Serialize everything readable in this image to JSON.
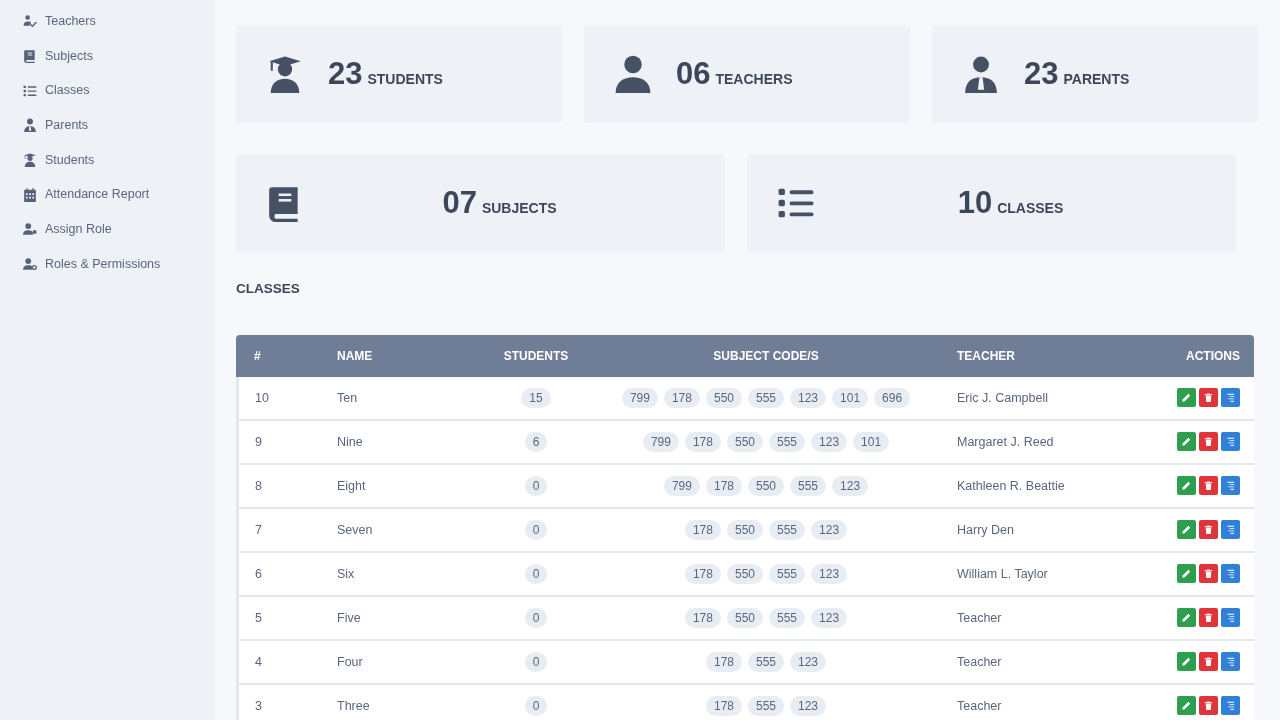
{
  "sidebar": {
    "items": [
      {
        "label": "Teachers",
        "kind": "teacher"
      },
      {
        "label": "Subjects",
        "kind": "book"
      },
      {
        "label": "Classes",
        "kind": "list"
      },
      {
        "label": "Parents",
        "kind": "parent"
      },
      {
        "label": "Students",
        "kind": "student"
      },
      {
        "label": "Attendance Report",
        "kind": "calendar"
      },
      {
        "label": "Assign Role",
        "kind": "assign"
      },
      {
        "label": "Roles & Permissions",
        "kind": "roles"
      }
    ]
  },
  "stats": [
    [
      {
        "count": "23",
        "label": "STUDENTS",
        "kind": "student"
      },
      {
        "count": "06",
        "label": "TEACHERS",
        "kind": "person"
      },
      {
        "count": "23",
        "label": "PARENTS",
        "kind": "parent"
      }
    ],
    [
      {
        "count": "07",
        "label": "SUBJECTS",
        "kind": "book"
      },
      {
        "count": "10",
        "label": "CLASSES",
        "kind": "list"
      }
    ]
  ],
  "section_title": "CLASSES",
  "table": {
    "columns": [
      "#",
      "NAME",
      "STUDENTS",
      "SUBJECT CODE/S",
      "TEACHER",
      "ACTIONS"
    ],
    "rows": [
      {
        "id": "10",
        "name": "Ten",
        "students": "15",
        "codes": [
          "799",
          "178",
          "550",
          "555",
          "123",
          "101",
          "696"
        ],
        "teacher": "Eric J. Campbell"
      },
      {
        "id": "9",
        "name": "Nine",
        "students": "6",
        "codes": [
          "799",
          "178",
          "550",
          "555",
          "123",
          "101"
        ],
        "teacher": "Margaret J. Reed"
      },
      {
        "id": "8",
        "name": "Eight",
        "students": "0",
        "codes": [
          "799",
          "178",
          "550",
          "555",
          "123"
        ],
        "teacher": "Kathleen R. Beattie"
      },
      {
        "id": "7",
        "name": "Seven",
        "students": "0",
        "codes": [
          "178",
          "550",
          "555",
          "123"
        ],
        "teacher": "Harry Den"
      },
      {
        "id": "6",
        "name": "Six",
        "students": "0",
        "codes": [
          "178",
          "550",
          "555",
          "123"
        ],
        "teacher": "William L. Taylor"
      },
      {
        "id": "5",
        "name": "Five",
        "students": "0",
        "codes": [
          "178",
          "550",
          "555",
          "123"
        ],
        "teacher": "Teacher"
      },
      {
        "id": "4",
        "name": "Four",
        "students": "0",
        "codes": [
          "178",
          "555",
          "123"
        ],
        "teacher": "Teacher"
      },
      {
        "id": "3",
        "name": "Three",
        "students": "0",
        "codes": [
          "178",
          "555",
          "123"
        ],
        "teacher": "Teacher"
      }
    ]
  }
}
